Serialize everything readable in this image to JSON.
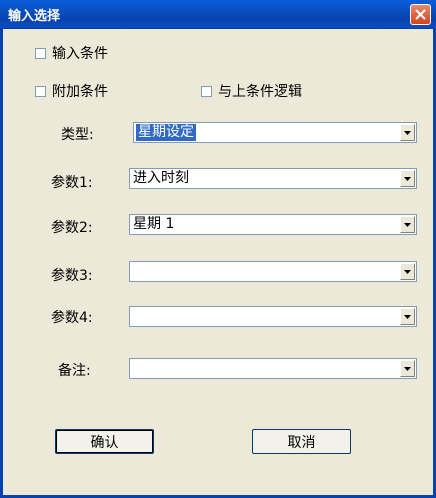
{
  "window": {
    "title": "输入选择"
  },
  "checkboxes": {
    "input_condition": "输入条件",
    "additional_condition": "附加条件",
    "and_previous_logic": "与上条件逻辑"
  },
  "fields": [
    {
      "label": "类型:",
      "value": "星期设定",
      "selected": true
    },
    {
      "label": "参数1:",
      "value": "进入时刻"
    },
    {
      "label": "参数2:",
      "value": "星期 1"
    },
    {
      "label": "参数3:",
      "value": ""
    },
    {
      "label": "参数4:",
      "value": ""
    },
    {
      "label": "备注:",
      "value": ""
    }
  ],
  "buttons": {
    "ok": "确认",
    "cancel": "取消"
  },
  "icons": {
    "close": "close-icon",
    "dropdown": "chevron-down-icon"
  },
  "colors": {
    "title_bar": "#0842b0",
    "selection": "#316ac5",
    "dialog_bg": "#ece9d8"
  }
}
